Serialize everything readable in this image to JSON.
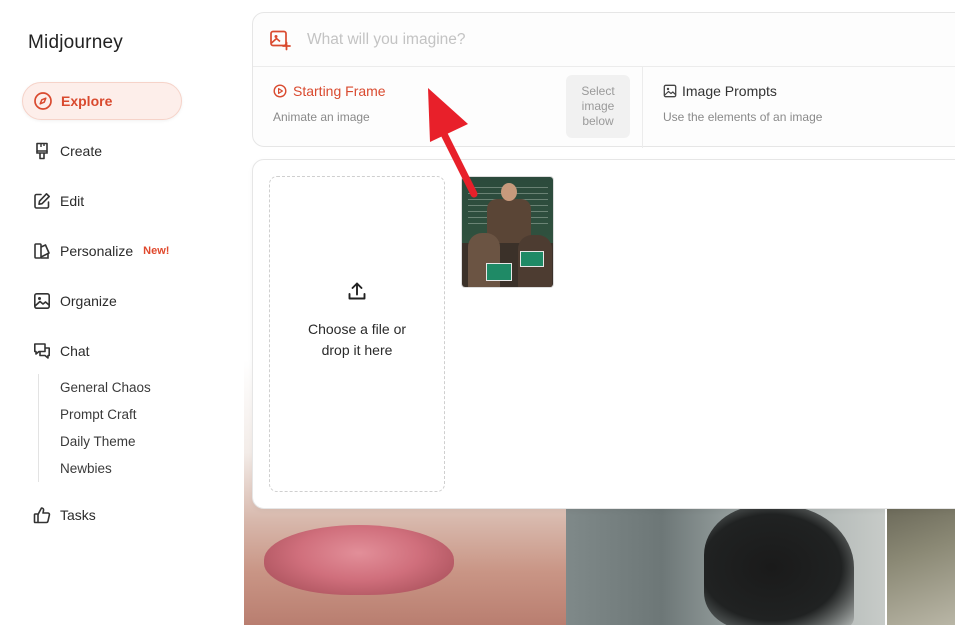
{
  "sidebar": {
    "brand": "Midjourney",
    "items": [
      {
        "label": "Explore",
        "icon": "compass-icon",
        "active": true
      },
      {
        "label": "Create",
        "icon": "brush-icon"
      },
      {
        "label": "Edit",
        "icon": "edit-icon"
      },
      {
        "label": "Personalize",
        "icon": "palette-icon",
        "badge": "New!"
      },
      {
        "label": "Organize",
        "icon": "image-icon"
      },
      {
        "label": "Chat",
        "icon": "chat-icon"
      },
      {
        "label": "Tasks",
        "icon": "thumbs-up-icon"
      }
    ],
    "chat_channels": [
      "General Chaos",
      "Prompt Craft",
      "Daily Theme",
      "Newbies"
    ]
  },
  "prompt": {
    "placeholder": "What will you imagine?",
    "starting_frame": {
      "title": "Starting Frame",
      "subtitle": "Animate an image"
    },
    "select_hint": "Select image below",
    "image_prompts": {
      "title": "Image Prompts",
      "subtitle": "Use the elements of an image"
    }
  },
  "upload": {
    "dropzone_text": "Choose a file or drop it here"
  },
  "colors": {
    "accent": "#d94a2f",
    "active_bg": "#fdeeea",
    "annotation_arrow": "#e8202a"
  }
}
